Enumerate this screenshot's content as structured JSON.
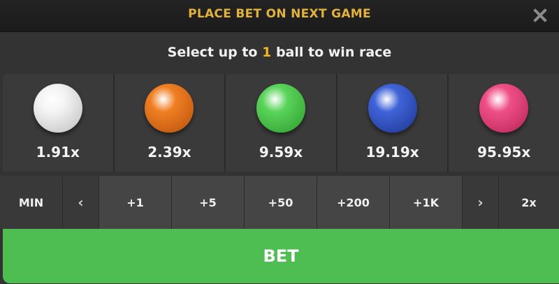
{
  "header": {
    "title": "PLACE BET ON NEXT GAME"
  },
  "instruction": {
    "prefix": "Select up to ",
    "count": "1",
    "suffix": " ball to win race"
  },
  "balls": [
    {
      "odds": "1.91x",
      "color": "#f4f4f4",
      "shade": "#bdbdbd",
      "icon": "white-ball-icon"
    },
    {
      "odds": "2.39x",
      "color": "#f07f22",
      "shade": "#b5500d",
      "icon": "orange-ball-icon"
    },
    {
      "odds": "9.59x",
      "color": "#5ad45a",
      "shade": "#2c9a2c",
      "icon": "green-ball-icon"
    },
    {
      "odds": "19.19x",
      "color": "#3f63d8",
      "shade": "#1e3590",
      "icon": "blue-ball-icon"
    },
    {
      "odds": "95.95x",
      "color": "#ef4f86",
      "shade": "#b52356",
      "icon": "pink-ball-icon"
    }
  ],
  "amounts": {
    "min": "MIN",
    "prev": "‹",
    "chips": [
      "+1",
      "+5",
      "+50",
      "+200",
      "+1K"
    ],
    "next": "›",
    "double": "2x"
  },
  "bet_button": {
    "label": "BET",
    "color": "#4ebd52"
  },
  "accent": {
    "title": "#e3b23c",
    "highlight": "#f2b824"
  }
}
